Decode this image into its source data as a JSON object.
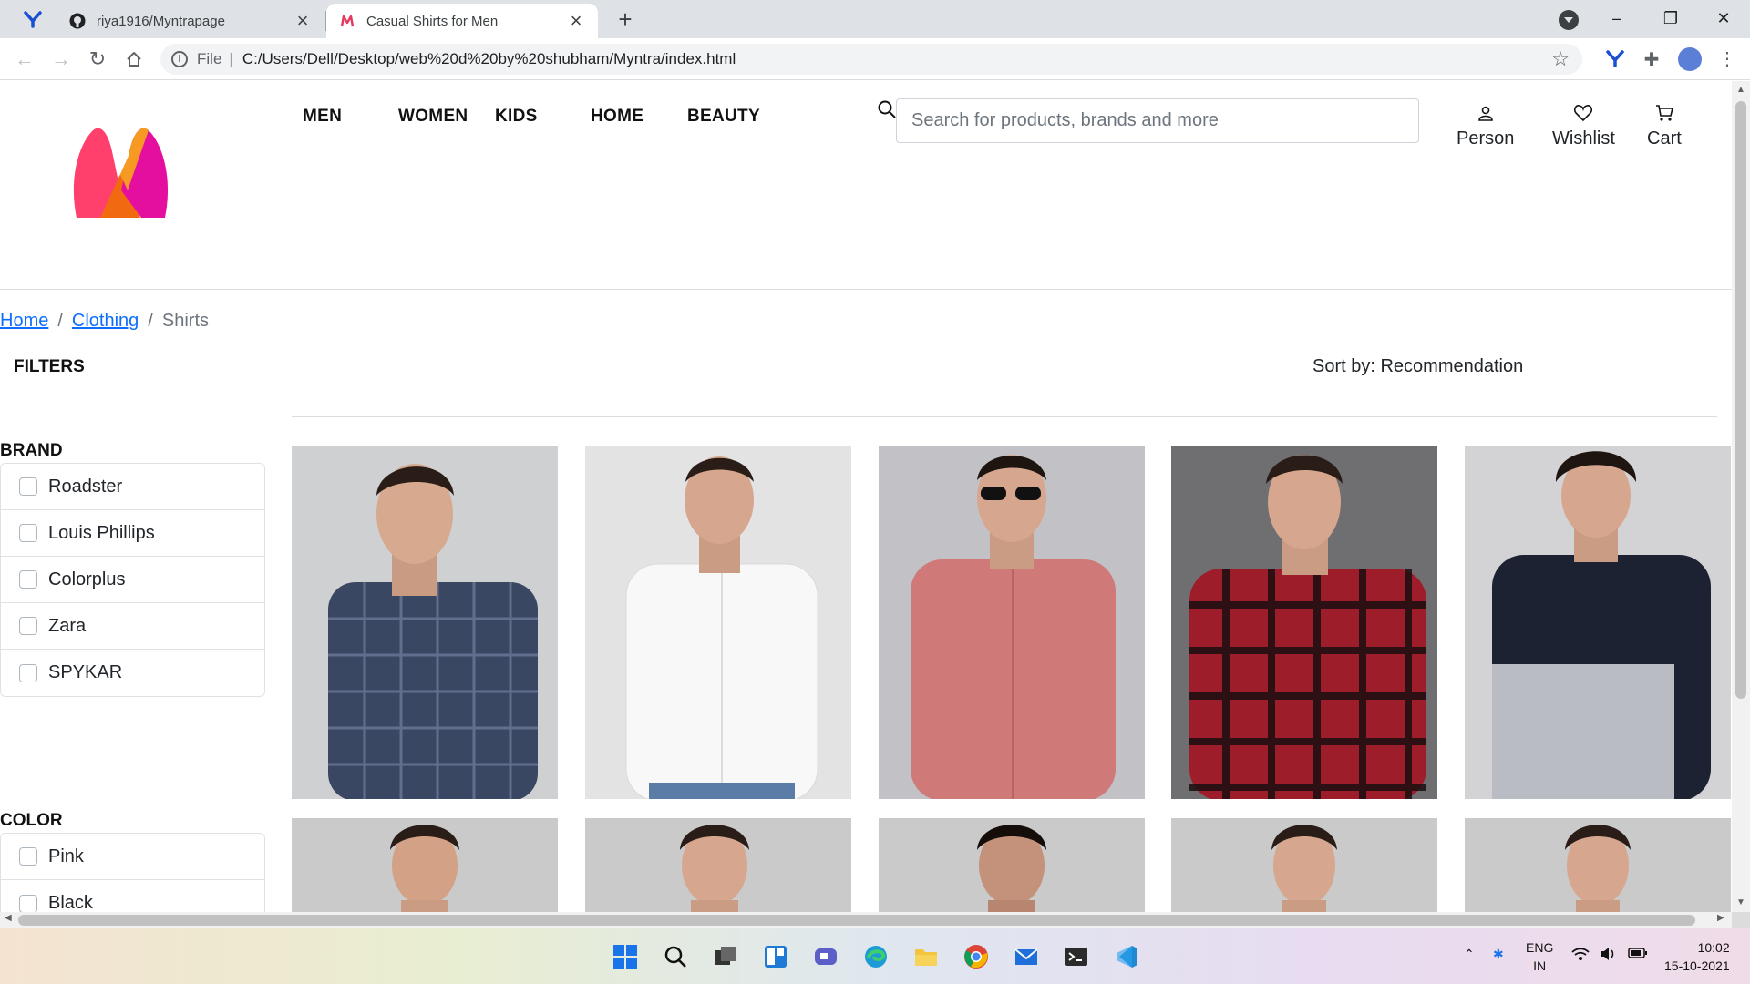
{
  "browser": {
    "tabs": [
      {
        "title": "riya1916/Myntrapage",
        "active": false
      },
      {
        "title": "Casual Shirts for Men",
        "active": true
      }
    ],
    "close_glyph": "×",
    "new_tab_glyph": "+",
    "url_scheme": "File",
    "url": "C:/Users/Dell/Desktop/web%20d%20by%20shubham/Myntra/index.html",
    "window_controls": [
      "–",
      "❐",
      "✕"
    ]
  },
  "site": {
    "brand_colors": {
      "pink": "#ff3f6c",
      "orange": "#f26a10",
      "magenta": "#e40f9e"
    },
    "nav": [
      "MEN",
      "WOMEN",
      "KIDS",
      "HOME",
      "BEAUTY"
    ],
    "search_placeholder": "Search for products, brands and more",
    "actions": [
      {
        "label": "Person",
        "icon": "person-icon"
      },
      {
        "label": "Wishlist",
        "icon": "heart-icon"
      },
      {
        "label": "Cart",
        "icon": "cart-icon"
      }
    ]
  },
  "breadcrumb": {
    "items": [
      "Home",
      "Clothing",
      "Shirts"
    ],
    "separator": "/"
  },
  "filters": {
    "title": "FILTERS",
    "brand": {
      "title": "BRAND",
      "options": [
        "Roadster",
        "Louis Phillips",
        "Colorplus",
        "Zara",
        "SPYKAR"
      ]
    },
    "color": {
      "title": "COLOR",
      "options": [
        "Pink",
        "Black"
      ]
    }
  },
  "sort_label": "Sort by: Recommendation",
  "products": [
    {
      "shirt": "navy-check",
      "color": "#3a4763",
      "bg": "#cfd0d2"
    },
    {
      "shirt": "white",
      "color": "#f4f4f4",
      "bg": "#e3e3e3"
    },
    {
      "shirt": "pink",
      "color": "#cf7a78",
      "bg": "#c2c2c6"
    },
    {
      "shirt": "red-check",
      "color": "#9e1d2a",
      "bg": "#6f6f72"
    },
    {
      "shirt": "navy-grey",
      "color": "#1d2233",
      "bg": "#d3d3d6"
    }
  ],
  "taskbar": {
    "lang": [
      "ENG",
      "IN"
    ],
    "time": "10:02",
    "date": "15-10-2021"
  }
}
